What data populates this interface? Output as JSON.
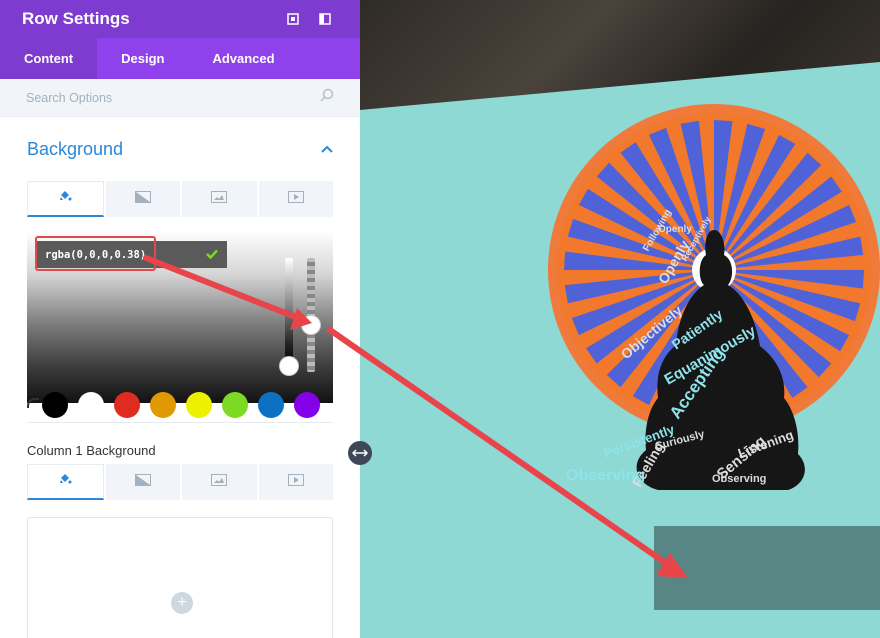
{
  "panel": {
    "title": "Row Settings",
    "tabs": [
      {
        "label": "Content",
        "active": true
      },
      {
        "label": "Design",
        "active": false
      },
      {
        "label": "Advanced",
        "active": false
      }
    ],
    "search_placeholder": "Search Options",
    "section_title": "Background",
    "color_value": "rgba(0,0,0,0.38)",
    "swatch_colors": [
      "#000000",
      "#ffffff",
      "#e02b20",
      "#e09900",
      "#edf000",
      "#7cda24",
      "#0c71c3",
      "#8300e9"
    ],
    "column_label": "Column 1 Background",
    "icons": {
      "expand": "expand-icon",
      "sidebar": "sidebar-toggle-icon",
      "search": "search-icon",
      "collapse": "chevron-up-icon",
      "color": "paint-bucket-icon",
      "gradient": "gradient-icon",
      "image": "image-icon",
      "video": "video-icon",
      "confirm": "checkmark-icon",
      "add": "plus-icon",
      "resize": "horizontal-resize-icon"
    }
  },
  "colors": {
    "purple_dark": "#7e3bd0",
    "purple": "#8f42ec",
    "accent_blue": "#2b87da",
    "annotation_red": "#e24a4a",
    "teal_bg": "#8fd9d5"
  },
  "preview": {
    "mandala_words": [
      "Openly",
      "Following",
      "Openly",
      "Receptively",
      "Objectively",
      "Patiently",
      "Equanimously",
      "Accepting",
      "Persistently",
      "Curiously",
      "Feeling",
      "Observing",
      "Sensing",
      "Listening",
      "Observing"
    ]
  }
}
